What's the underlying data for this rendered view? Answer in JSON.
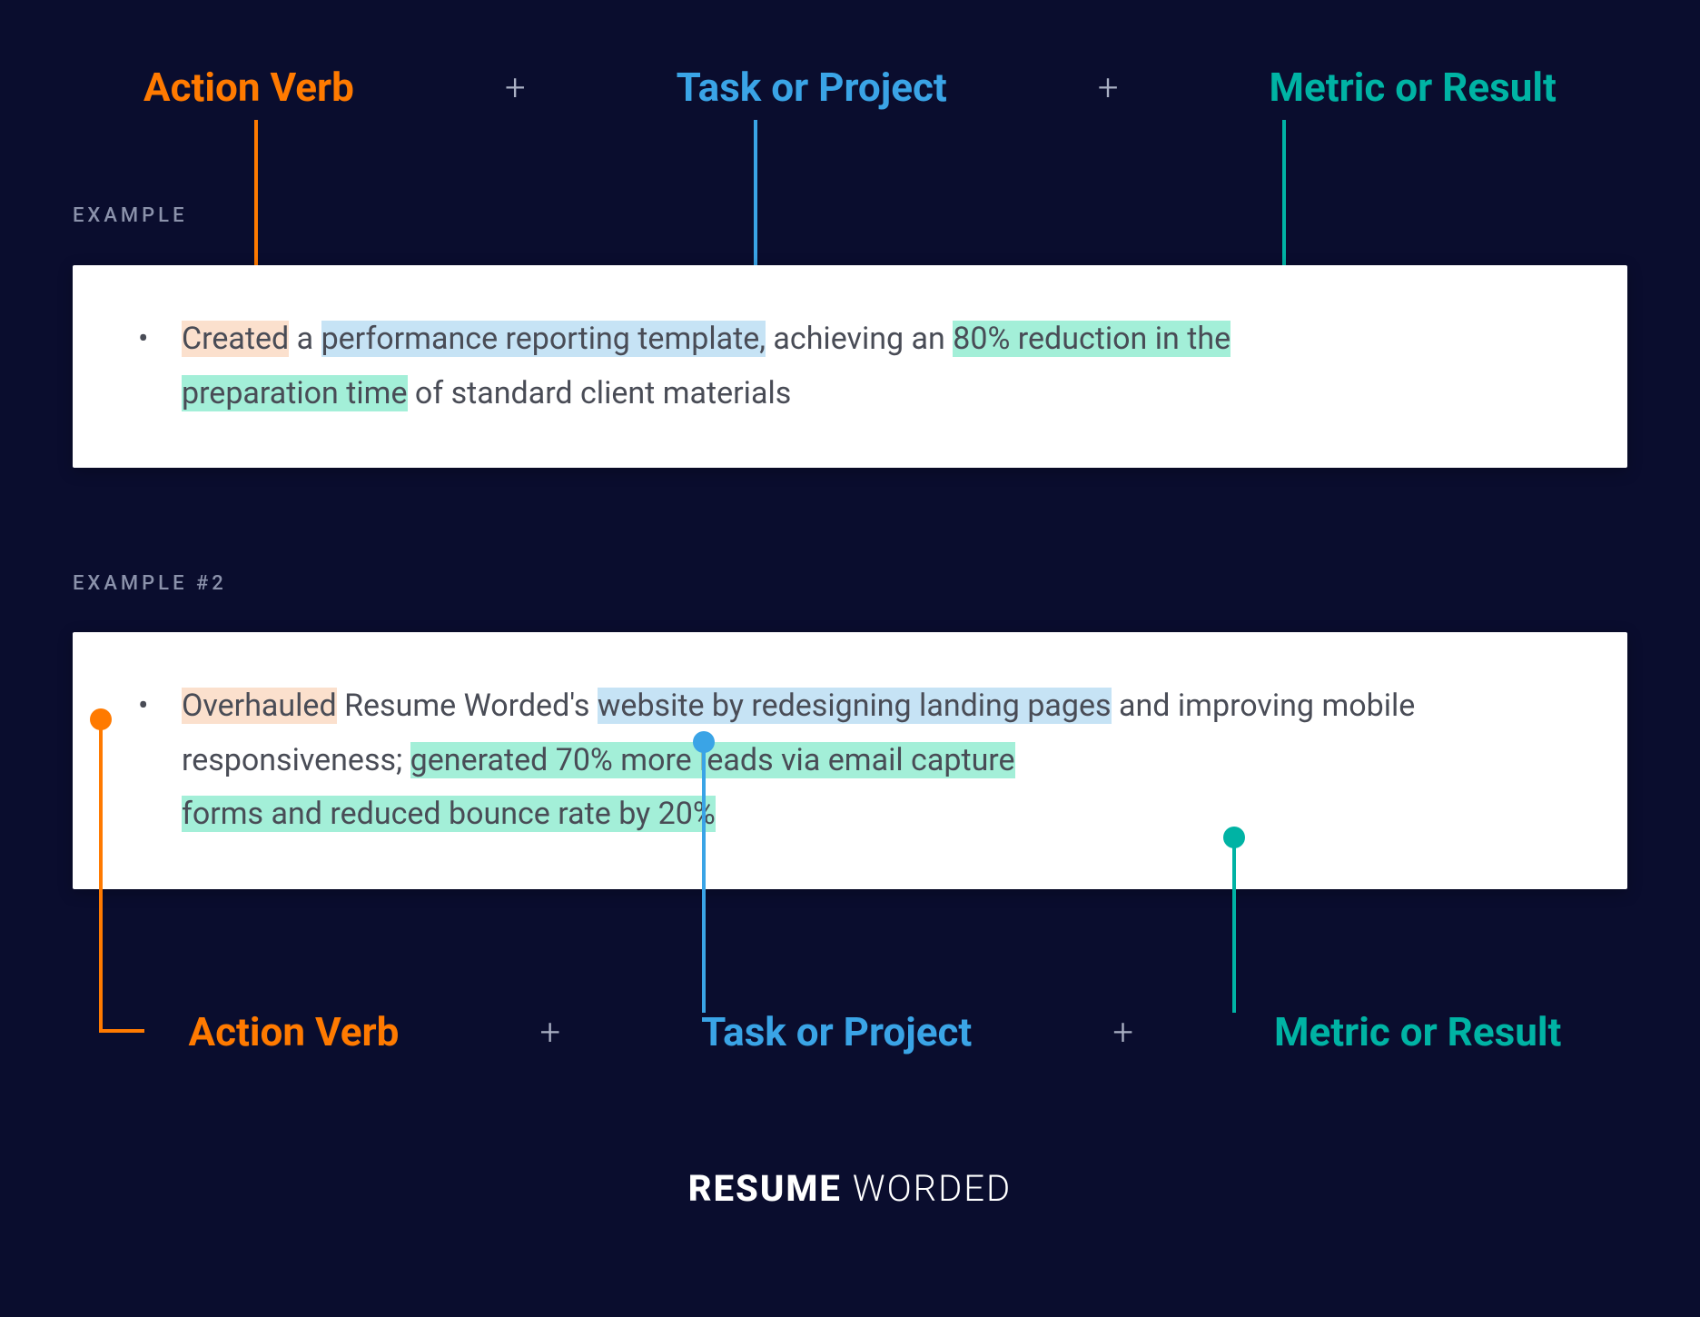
{
  "formula": {
    "action_verb": "Action Verb",
    "task": "Task or Project",
    "result": "Metric or Result",
    "plus": "+"
  },
  "labels": {
    "example1": "EXAMPLE",
    "example2": "EXAMPLE #2"
  },
  "example1": {
    "verb": "Created",
    "plain1": " a ",
    "task": "performance reporting template,",
    "plain2": " achieving an ",
    "result1": "80% reduction in the",
    "result2": "preparation time",
    "plain3": " of standard client materials"
  },
  "example2": {
    "verb": "Overhauled",
    "plain1": " Resume Worded's ",
    "task": "website by redesigning landing pages",
    "plain2": " and improving mobile responsiveness; ",
    "result1": "generated 70% more leads via email capture",
    "result2": "forms and reduced bounce rate by 20%"
  },
  "brand": {
    "first": "RESUME",
    "second": "WORDED"
  },
  "colors": {
    "orange": "#ff7a00",
    "blue": "#3aa4e6",
    "teal": "#00b3a4",
    "bg": "#0a0d2e"
  }
}
